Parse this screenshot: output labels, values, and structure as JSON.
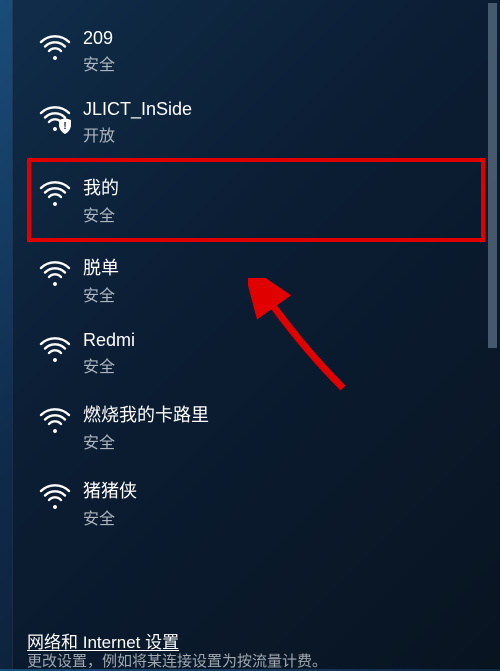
{
  "networks": [
    {
      "ssid": "209",
      "status": "安全",
      "icon": "wifi-secure-icon",
      "highlighted": false
    },
    {
      "ssid": "JLICT_InSide",
      "status": "开放",
      "icon": "wifi-open-icon",
      "highlighted": false
    },
    {
      "ssid": "我的",
      "status": "安全",
      "icon": "wifi-secure-icon",
      "highlighted": true
    },
    {
      "ssid": "脱单",
      "status": "安全",
      "icon": "wifi-secure-icon",
      "highlighted": false
    },
    {
      "ssid": "Redmi",
      "status": "安全",
      "icon": "wifi-secure-icon",
      "highlighted": false
    },
    {
      "ssid": "燃烧我的卡路里",
      "status": "安全",
      "icon": "wifi-secure-icon",
      "highlighted": false
    },
    {
      "ssid": "猪猪侠",
      "status": "安全",
      "icon": "wifi-secure-icon",
      "highlighted": false
    }
  ],
  "settings_link": "网络和 Internet 设置",
  "truncated": "更改设置，例如将某连接设置为按流量计费。",
  "colors": {
    "highlight": "#e00000",
    "text": "#ffffff",
    "sub": "#aeb7c0"
  }
}
